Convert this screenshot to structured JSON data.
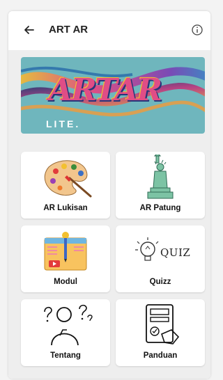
{
  "appbar": {
    "title": "ART AR",
    "back_icon": "arrow-back-icon",
    "info_icon": "info-icon"
  },
  "banner": {
    "logo_text": "ARTAR",
    "tagline": "LITE.",
    "colors": {
      "background": "#6fb6bd",
      "accent_pink": "#e8437f",
      "accent_orange": "#f29b38"
    }
  },
  "menu": [
    {
      "label": "AR Lukisan",
      "icon": "palette-icon"
    },
    {
      "label": "AR Patung",
      "icon": "statue-of-liberty-icon"
    },
    {
      "label": "Modul",
      "icon": "module-book-icon"
    },
    {
      "label": "Quizz",
      "icon": "quiz-lightbulb-icon",
      "icon_text": "QUIZ"
    },
    {
      "label": "Tentang",
      "icon": "thinking-person-icon"
    },
    {
      "label": "Panduan",
      "icon": "guide-document-icon"
    }
  ]
}
